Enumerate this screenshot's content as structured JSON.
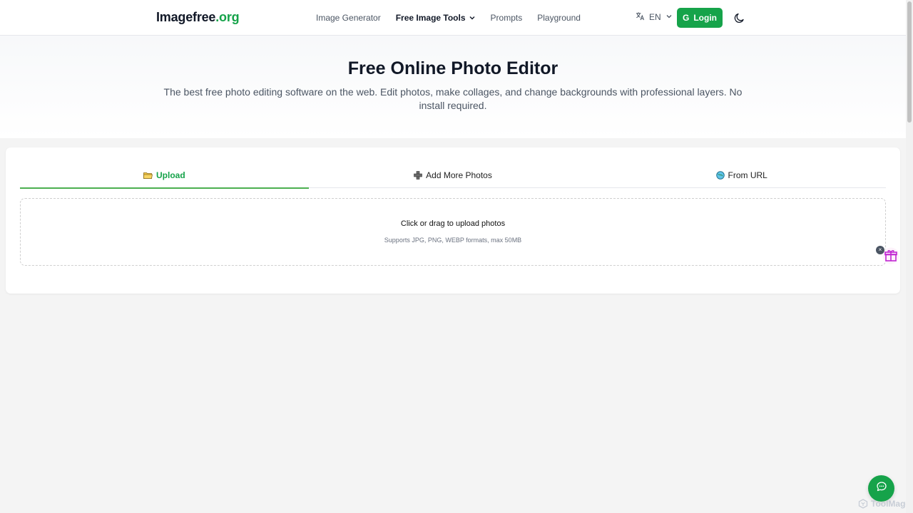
{
  "header": {
    "logo_main": "Imagefree",
    "logo_tld": ".org",
    "nav": [
      {
        "label": "Image Generator"
      },
      {
        "label": "Free Image Tools"
      },
      {
        "label": "Prompts"
      },
      {
        "label": "Playground"
      }
    ],
    "language": "EN",
    "login_label": "Login",
    "login_icon_letter": "G"
  },
  "hero": {
    "title": "Free Online Photo Editor",
    "description": "The best free photo editing software on the web. Edit photos, make collages, and change backgrounds with professional layers. No install required."
  },
  "upload_card": {
    "tabs": [
      {
        "label": "Upload",
        "icon": "folder-icon",
        "active": true
      },
      {
        "label": "Add More Photos",
        "icon": "plus-icon",
        "active": false
      },
      {
        "label": "From URL",
        "icon": "globe-icon",
        "active": false
      }
    ],
    "dropzone": {
      "title": "Click or drag to upload photos",
      "subtitle": "Supports JPG, PNG, WEBP formats, max 50MB"
    }
  },
  "widgets": {
    "gift_close": "×",
    "watermark": "ToolMage"
  },
  "colors": {
    "accent": "#16a34a",
    "tab_underline": "#4caf50",
    "background": "#f4f4f4"
  }
}
